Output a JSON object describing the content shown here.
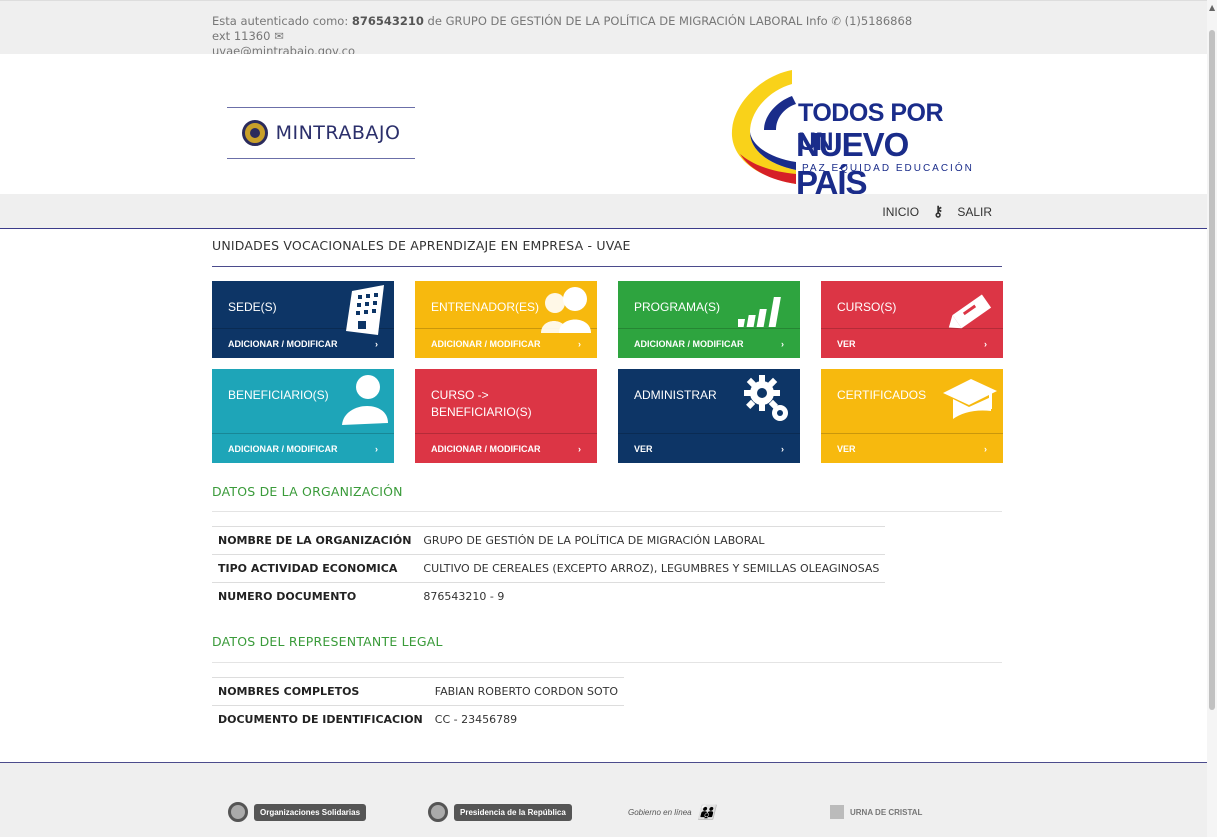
{
  "auth": {
    "prefix": "Esta autenticado como: ",
    "user_id": "876543210",
    "middle": " de GRUPO DE GESTIÓN DE LA POLÍTICA DE MIGRACIÓN LABORAL  Info ",
    "phone": "(1)5186868 ext 11360",
    "email": "uvae@mintrabajo.gov.co"
  },
  "logos": {
    "mintrabajo": "MINTRABAJO",
    "todos_line1": "TODOS POR UN",
    "todos_line2": "NUEVO PAÍS",
    "todos_line3": "PAZ  EQUIDAD  EDUCACIÓN"
  },
  "nav": {
    "inicio": "INICIO",
    "salir": "SALIR"
  },
  "page_title": "UNIDADES VOCACIONALES DE APRENDIZAJE EN EMPRESA - UVAE",
  "tiles": [
    {
      "name": "SEDE(S)",
      "action": "ADICIONAR / MODIFICAR",
      "color": "#0d3566",
      "icon": "building-icon"
    },
    {
      "name": "ENTRENADOR(ES)",
      "action": "ADICIONAR / MODIFICAR",
      "color": "#f7b90e",
      "icon": "users-icon"
    },
    {
      "name": "PROGRAMA(S)",
      "action": "ADICIONAR / MODIFICAR",
      "color": "#2ea43f",
      "icon": "signal-bars-icon"
    },
    {
      "name": "CURSO(S)",
      "action": "VER",
      "color": "#dc3545",
      "icon": "pencil-icon"
    },
    {
      "name": "BENEFICIARIO(S)",
      "action": "ADICIONAR / MODIFICAR",
      "color": "#1ea5b8",
      "icon": "user-icon"
    },
    {
      "name": "CURSO ->\nBENEFICIARIO(S)",
      "action": "ADICIONAR / MODIFICAR",
      "color": "#dc3545",
      "icon": "none"
    },
    {
      "name": "ADMINISTRAR",
      "action": "VER",
      "color": "#0d3566",
      "icon": "gears-icon"
    },
    {
      "name": "CERTIFICADOS",
      "action": "VER",
      "color": "#f7b90e",
      "icon": "graduation-cap-icon"
    }
  ],
  "org": {
    "title": "DATOS DE LA ORGANIZACIÓN",
    "rows": [
      {
        "label": "NOMBRE DE LA ORGANIZACIÓN",
        "value": "GRUPO DE GESTIÓN DE LA POLÍTICA DE MIGRACIÓN LABORAL"
      },
      {
        "label": "TIPO ACTIVIDAD ECONOMICA",
        "value": "CULTIVO DE CEREALES (EXCEPTO ARROZ), LEGUMBRES Y SEMILLAS OLEAGINOSAS"
      },
      {
        "label": "NUMERO DOCUMENTO",
        "value": "876543210 - 9"
      }
    ]
  },
  "rep": {
    "title": "DATOS DEL REPRESENTANTE LEGAL",
    "rows": [
      {
        "label": "NOMBRES COMPLETOS",
        "value": "FABIAN ROBERTO CORDON SOTO"
      },
      {
        "label": "DOCUMENTO DE IDENTIFICACION",
        "value": "CC - 23456789"
      }
    ]
  },
  "footer": {
    "logo1": "Organizaciones Solidarias",
    "logo2": "Presidencia de la República",
    "logo3": "Gobierno en línea",
    "logo4": "URNA DE CRISTAL"
  }
}
